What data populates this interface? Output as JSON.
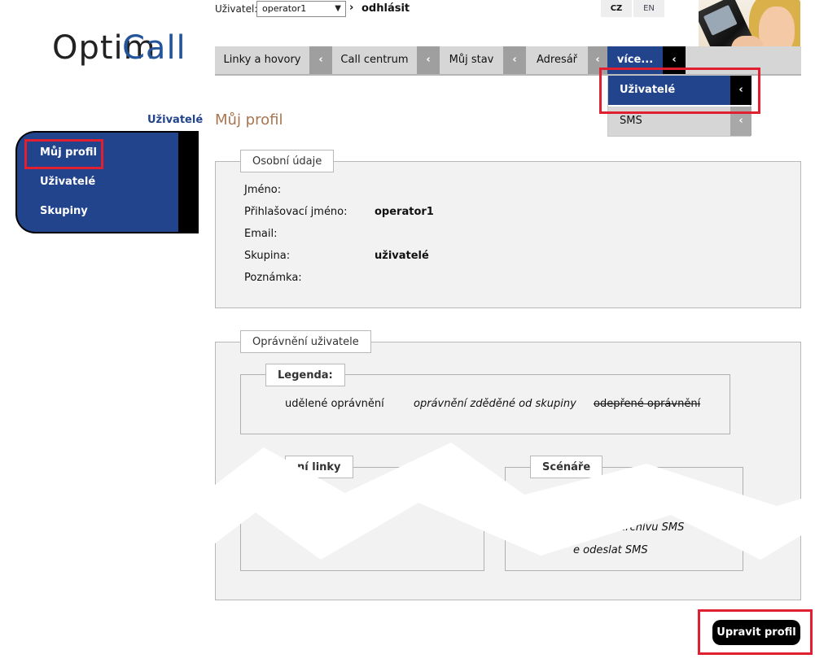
{
  "topbar": {
    "user_label": "Uživatel:",
    "user_select_value": "operator1",
    "logout_label": "odhlásit",
    "languages": [
      "CZ",
      "EN"
    ]
  },
  "logo": {
    "part1": "Optim",
    "part2": "Call"
  },
  "nav": {
    "tabs": [
      "Linky a hovory",
      "Call centrum",
      "Můj stav",
      "Adresář",
      "více..."
    ],
    "dropdown": [
      "Uživatelé",
      "SMS"
    ]
  },
  "sidebar": {
    "heading": "Uživatelé",
    "items": [
      "Můj profil",
      "Uživatelé",
      "Skupiny"
    ]
  },
  "page": {
    "title": "Můj profil",
    "personal": {
      "legend": "Osobní údaje",
      "rows": [
        {
          "label": "Jméno:",
          "value": ""
        },
        {
          "label": "Přihlašovací jméno:",
          "value": "operator1"
        },
        {
          "label": "Email:",
          "value": ""
        },
        {
          "label": "Skupina:",
          "value": "uživatelé"
        },
        {
          "label": "Poznámka:",
          "value": ""
        }
      ]
    },
    "permissions": {
      "legend": "Oprávnění uživatele",
      "legend_box": {
        "title": "Legenda:",
        "granted": "udělené oprávnění",
        "inherited": "oprávnění zděděné od skupiny",
        "denied": "odepřené oprávnění"
      },
      "left_group_title": "ní linky",
      "right_group_title": "Scénáře",
      "right_items": [
        ". archivu SMS",
        "e odeslat SMS"
      ]
    },
    "edit_button": "Upravit profil"
  },
  "colors": {
    "brand_blue": "#22448c",
    "title_brown": "#a87550",
    "highlight_red": "#e02030"
  }
}
